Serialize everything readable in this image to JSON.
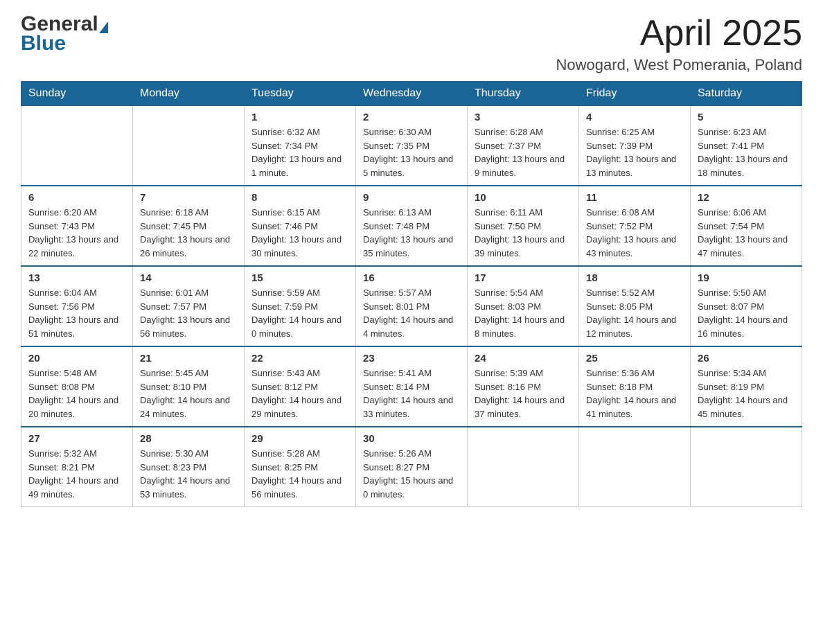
{
  "header": {
    "month_year": "April 2025",
    "location": "Nowogard, West Pomerania, Poland",
    "logo_general": "General",
    "logo_blue": "Blue"
  },
  "days_of_week": [
    "Sunday",
    "Monday",
    "Tuesday",
    "Wednesday",
    "Thursday",
    "Friday",
    "Saturday"
  ],
  "weeks": [
    [
      {
        "day": "",
        "info": ""
      },
      {
        "day": "",
        "info": ""
      },
      {
        "day": "1",
        "info": "Sunrise: 6:32 AM\nSunset: 7:34 PM\nDaylight: 13 hours\nand 1 minute."
      },
      {
        "day": "2",
        "info": "Sunrise: 6:30 AM\nSunset: 7:35 PM\nDaylight: 13 hours\nand 5 minutes."
      },
      {
        "day": "3",
        "info": "Sunrise: 6:28 AM\nSunset: 7:37 PM\nDaylight: 13 hours\nand 9 minutes."
      },
      {
        "day": "4",
        "info": "Sunrise: 6:25 AM\nSunset: 7:39 PM\nDaylight: 13 hours\nand 13 minutes."
      },
      {
        "day": "5",
        "info": "Sunrise: 6:23 AM\nSunset: 7:41 PM\nDaylight: 13 hours\nand 18 minutes."
      }
    ],
    [
      {
        "day": "6",
        "info": "Sunrise: 6:20 AM\nSunset: 7:43 PM\nDaylight: 13 hours\nand 22 minutes."
      },
      {
        "day": "7",
        "info": "Sunrise: 6:18 AM\nSunset: 7:45 PM\nDaylight: 13 hours\nand 26 minutes."
      },
      {
        "day": "8",
        "info": "Sunrise: 6:15 AM\nSunset: 7:46 PM\nDaylight: 13 hours\nand 30 minutes."
      },
      {
        "day": "9",
        "info": "Sunrise: 6:13 AM\nSunset: 7:48 PM\nDaylight: 13 hours\nand 35 minutes."
      },
      {
        "day": "10",
        "info": "Sunrise: 6:11 AM\nSunset: 7:50 PM\nDaylight: 13 hours\nand 39 minutes."
      },
      {
        "day": "11",
        "info": "Sunrise: 6:08 AM\nSunset: 7:52 PM\nDaylight: 13 hours\nand 43 minutes."
      },
      {
        "day": "12",
        "info": "Sunrise: 6:06 AM\nSunset: 7:54 PM\nDaylight: 13 hours\nand 47 minutes."
      }
    ],
    [
      {
        "day": "13",
        "info": "Sunrise: 6:04 AM\nSunset: 7:56 PM\nDaylight: 13 hours\nand 51 minutes."
      },
      {
        "day": "14",
        "info": "Sunrise: 6:01 AM\nSunset: 7:57 PM\nDaylight: 13 hours\nand 56 minutes."
      },
      {
        "day": "15",
        "info": "Sunrise: 5:59 AM\nSunset: 7:59 PM\nDaylight: 14 hours\nand 0 minutes."
      },
      {
        "day": "16",
        "info": "Sunrise: 5:57 AM\nSunset: 8:01 PM\nDaylight: 14 hours\nand 4 minutes."
      },
      {
        "day": "17",
        "info": "Sunrise: 5:54 AM\nSunset: 8:03 PM\nDaylight: 14 hours\nand 8 minutes."
      },
      {
        "day": "18",
        "info": "Sunrise: 5:52 AM\nSunset: 8:05 PM\nDaylight: 14 hours\nand 12 minutes."
      },
      {
        "day": "19",
        "info": "Sunrise: 5:50 AM\nSunset: 8:07 PM\nDaylight: 14 hours\nand 16 minutes."
      }
    ],
    [
      {
        "day": "20",
        "info": "Sunrise: 5:48 AM\nSunset: 8:08 PM\nDaylight: 14 hours\nand 20 minutes."
      },
      {
        "day": "21",
        "info": "Sunrise: 5:45 AM\nSunset: 8:10 PM\nDaylight: 14 hours\nand 24 minutes."
      },
      {
        "day": "22",
        "info": "Sunrise: 5:43 AM\nSunset: 8:12 PM\nDaylight: 14 hours\nand 29 minutes."
      },
      {
        "day": "23",
        "info": "Sunrise: 5:41 AM\nSunset: 8:14 PM\nDaylight: 14 hours\nand 33 minutes."
      },
      {
        "day": "24",
        "info": "Sunrise: 5:39 AM\nSunset: 8:16 PM\nDaylight: 14 hours\nand 37 minutes."
      },
      {
        "day": "25",
        "info": "Sunrise: 5:36 AM\nSunset: 8:18 PM\nDaylight: 14 hours\nand 41 minutes."
      },
      {
        "day": "26",
        "info": "Sunrise: 5:34 AM\nSunset: 8:19 PM\nDaylight: 14 hours\nand 45 minutes."
      }
    ],
    [
      {
        "day": "27",
        "info": "Sunrise: 5:32 AM\nSunset: 8:21 PM\nDaylight: 14 hours\nand 49 minutes."
      },
      {
        "day": "28",
        "info": "Sunrise: 5:30 AM\nSunset: 8:23 PM\nDaylight: 14 hours\nand 53 minutes."
      },
      {
        "day": "29",
        "info": "Sunrise: 5:28 AM\nSunset: 8:25 PM\nDaylight: 14 hours\nand 56 minutes."
      },
      {
        "day": "30",
        "info": "Sunrise: 5:26 AM\nSunset: 8:27 PM\nDaylight: 15 hours\nand 0 minutes."
      },
      {
        "day": "",
        "info": ""
      },
      {
        "day": "",
        "info": ""
      },
      {
        "day": "",
        "info": ""
      }
    ]
  ]
}
